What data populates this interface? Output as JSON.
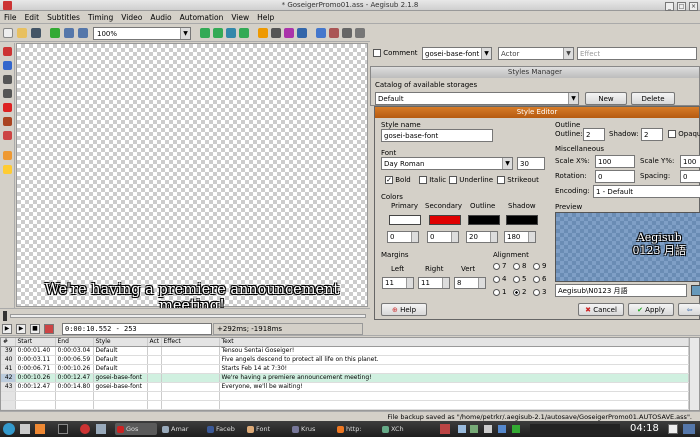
{
  "window": {
    "title": "* GoseigerPromo01.ass - Aegisub 2.1.8"
  },
  "menu": [
    "File",
    "Edit",
    "Subtitles",
    "Timing",
    "Video",
    "Audio",
    "Automation",
    "View",
    "Help"
  ],
  "toolbar": {
    "zoom": "100%"
  },
  "video": {
    "subtitle_text": "We're having a premiere announcement meeting!"
  },
  "transport": {
    "time": "0:00:10.552 - 253",
    "offset": "+292ms; -1918ms"
  },
  "edit": {
    "comment_label": "Comment",
    "style": "gosei-base-font",
    "actor": "Actor",
    "effect_placeholder": "Effect"
  },
  "styles_manager": {
    "title": "Styles Manager",
    "catalog_label": "Catalog of available storages",
    "catalog_value": "Default",
    "new_button": "New",
    "delete_button": "Delete"
  },
  "style_editor": {
    "title": "Style Editor",
    "style_name_label": "Style name",
    "style_name": "gosei-base-font",
    "font_label": "Font",
    "font_name": "Day Roman",
    "font_size": "30",
    "bold": "Bold",
    "italic": "Italic",
    "underline": "Underline",
    "strikeout": "Strikeout",
    "colors_label": "Colors",
    "color_names": [
      "Primary",
      "Secondary",
      "Outline",
      "Shadow"
    ],
    "color_values": [
      "#ffffff",
      "#e00000",
      "#000000",
      "#000000"
    ],
    "color_alpha": [
      "0",
      "0",
      "20",
      "180"
    ],
    "margins_label": "Margins",
    "margin_names": [
      "Left",
      "Right",
      "Vert"
    ],
    "margin_values": [
      "11",
      "11",
      "8"
    ],
    "alignment_label": "Alignment",
    "alignment_rows": [
      [
        "7",
        "8",
        "9"
      ],
      [
        "4",
        "5",
        "6"
      ],
      [
        "1",
        "2",
        "3"
      ]
    ],
    "alignment_selected": "2",
    "outline_label": "Outline",
    "outline_label2": "Outline:",
    "outline_value": "2",
    "shadow_label": "Shadow:",
    "shadow_value": "2",
    "opaque_label": "Opaqu",
    "misc_label": "Miscellaneous",
    "scalex_label": "Scale X%:",
    "scalex_value": "100",
    "scaley_label": "Scale Y%:",
    "scaley_value": "100",
    "rotation_label": "Rotation:",
    "rotation_value": "0",
    "spacing_label": "Spacing:",
    "spacing_value": "0",
    "encoding_label": "Encoding:",
    "encoding_value": "1 - Default",
    "preview_label": "Preview",
    "preview_line1": "Aegisub",
    "preview_line2": "0123 月語",
    "preview_text": "Aegisub\\N0123 月語",
    "help_button": "Help",
    "cancel_button": "Cancel",
    "apply_button": "Apply"
  },
  "grid": {
    "columns": [
      "#",
      "Start",
      "End",
      "Style",
      "Act",
      "Effect",
      "Text"
    ],
    "rows": [
      {
        "n": "39",
        "start": "0:00:01.40",
        "end": "0:00:03.04",
        "style": "Default",
        "text": "Tensou Sentai Goseiger!"
      },
      {
        "n": "40",
        "start": "0:00:03.11",
        "end": "0:00:06.59",
        "style": "Default",
        "text": "Five angels descend to protect all life on this planet."
      },
      {
        "n": "41",
        "start": "0:00:06.71",
        "end": "0:00:10.26",
        "style": "Default",
        "text": "Starts Feb 14 at 7:30!"
      },
      {
        "n": "42",
        "start": "0:00:10.26",
        "end": "0:00:12.47",
        "style": "gosei-base-font",
        "text": "We're having a premiere announcement meeting!"
      },
      {
        "n": "43",
        "start": "0:00:12.47",
        "end": "0:00:14.80",
        "style": "gosei-base-font",
        "text": "Everyone, we'll be waiting!"
      }
    ]
  },
  "status": {
    "message": "File backup saved as \"/home/petrkr/.aegisub-2.1/autosave/GoseigerPromo01.AUTOSAVE.ass\"."
  },
  "taskbar": {
    "tasks": [
      "Gos",
      "Amar",
      "Faceb",
      "Font",
      "Krus",
      "http:",
      "XCh"
    ],
    "task_colors": [
      "#c22",
      "#9ab",
      "#3b5998",
      "#da7",
      "#779",
      "#e72",
      "#6a8"
    ],
    "clock": "04:18"
  }
}
